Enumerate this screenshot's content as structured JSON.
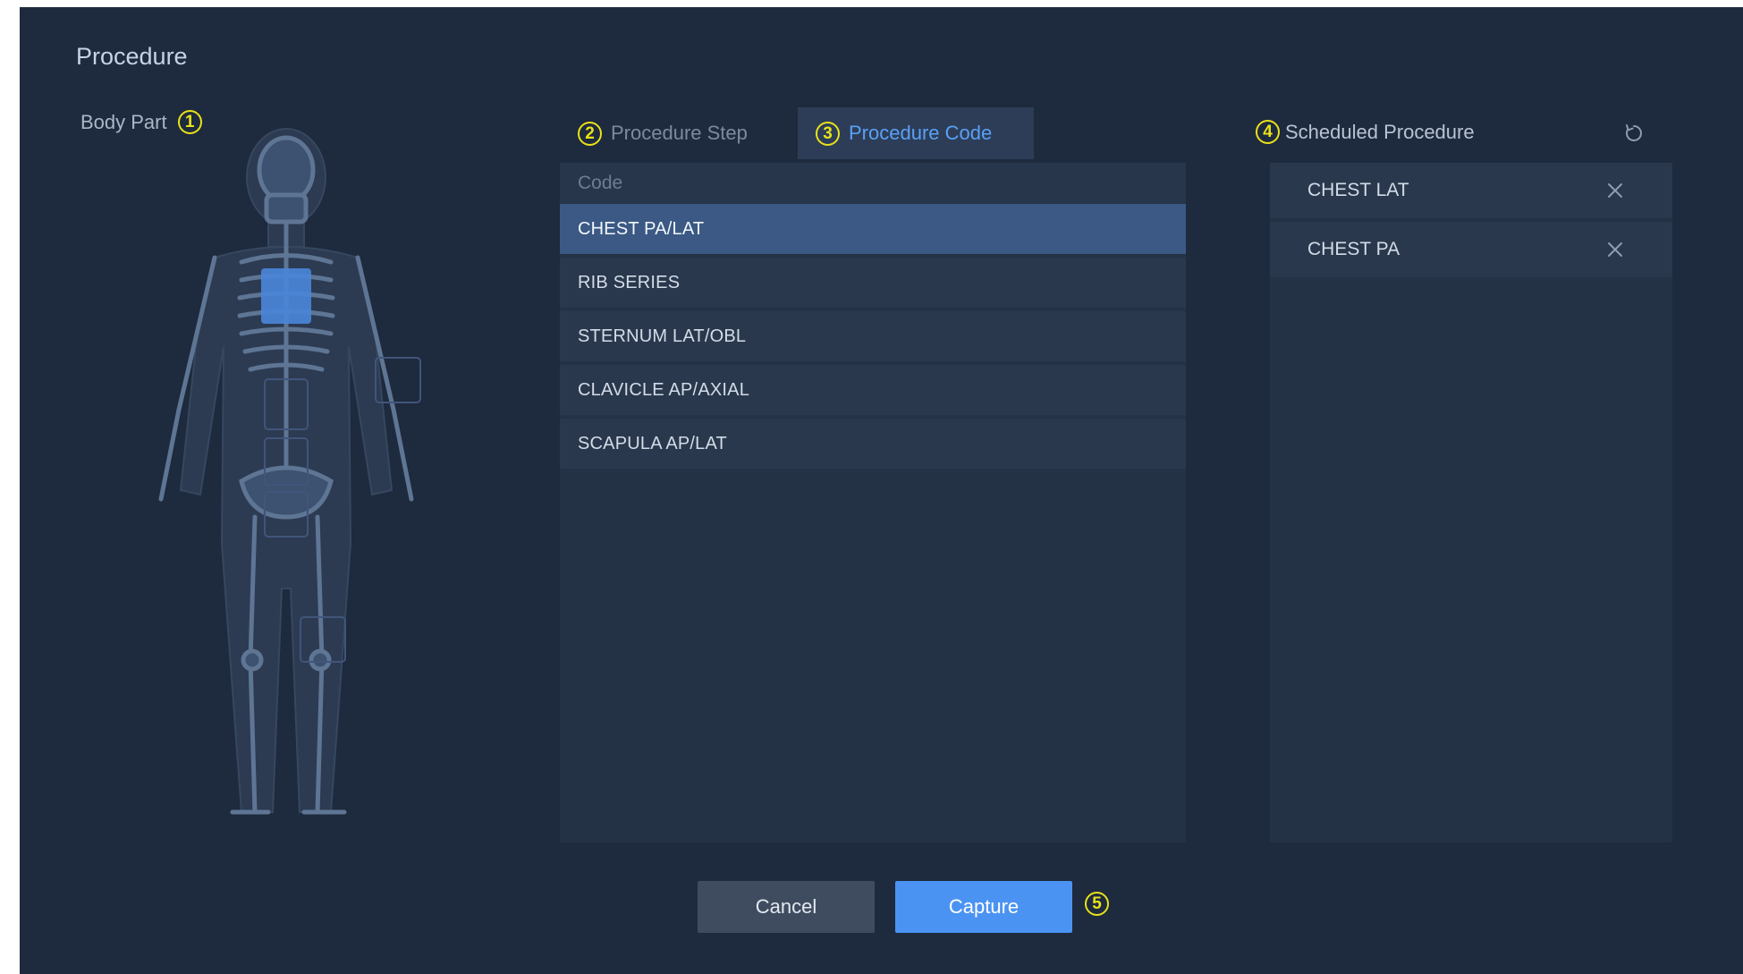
{
  "dialog": {
    "title": "Procedure"
  },
  "body_part": {
    "label": "Body Part",
    "callout": "1"
  },
  "tabs": [
    {
      "label": "Procedure Step",
      "callout": "2",
      "active": false
    },
    {
      "label": "Procedure Code",
      "callout": "3",
      "active": true
    }
  ],
  "codes": {
    "header": "Code",
    "rows": [
      {
        "label": "CHEST PA/LAT",
        "selected": true
      },
      {
        "label": "RIB SERIES",
        "selected": false
      },
      {
        "label": "STERNUM LAT/OBL",
        "selected": false
      },
      {
        "label": "CLAVICLE AP/AXIAL",
        "selected": false
      },
      {
        "label": "SCAPULA AP/LAT",
        "selected": false
      }
    ]
  },
  "scheduled": {
    "label": "Scheduled Procedure",
    "callout": "4",
    "refresh_icon": "refresh-icon",
    "items": [
      {
        "label": "CHEST LAT",
        "remove_icon": "close-icon"
      },
      {
        "label": "CHEST PA",
        "remove_icon": "close-icon"
      }
    ]
  },
  "actions": {
    "cancel_label": "Cancel",
    "capture_label": "Capture",
    "callout": "5"
  },
  "colors": {
    "background": "#1e2a3d",
    "panel": "#243246",
    "row": "#2a384d",
    "selected_row": "#3b5984",
    "accent": "#4b93f2",
    "active_tab_text": "#5aa0f5",
    "callout": "#e9e21a",
    "body_highlight": "#4a86d8"
  }
}
